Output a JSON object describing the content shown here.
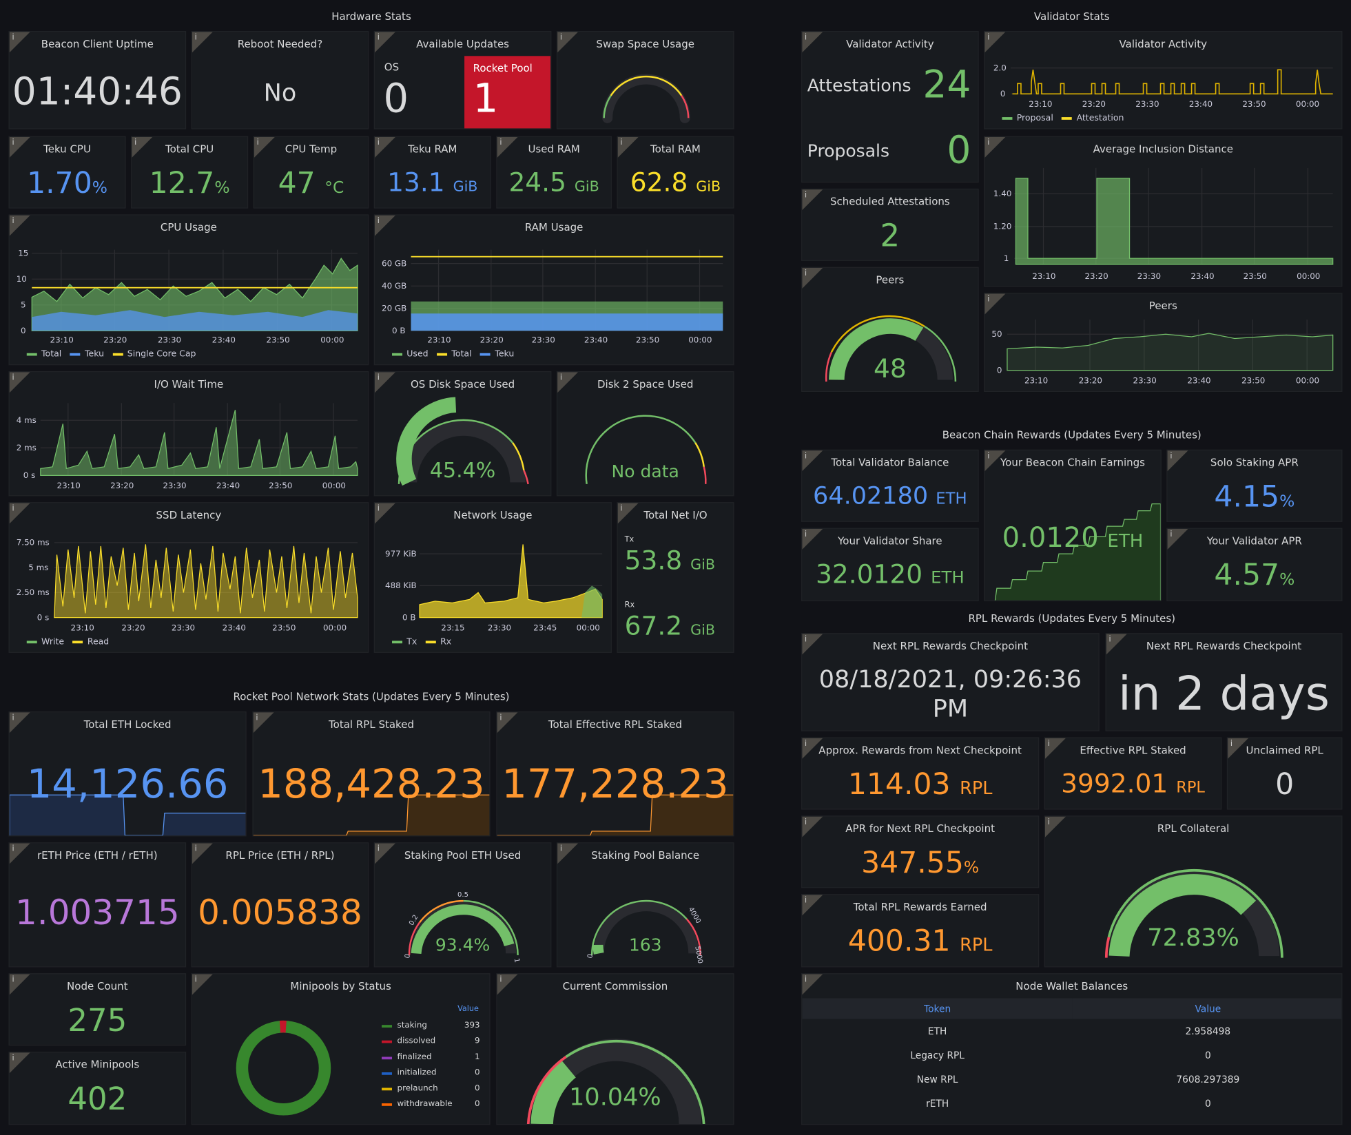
{
  "sections": {
    "hardware": "Hardware Stats",
    "validator": "Validator Stats",
    "beacon": "Beacon Chain Rewards (Updates Every 5 Minutes)",
    "rpl": "RPL Rewards (Updates Every 5 Minutes)",
    "network": "Rocket Pool Network Stats (Updates Every 5 Minutes)"
  },
  "info_icon": "i",
  "colors": {
    "green": "#73bf69",
    "blue": "#5794f2",
    "yellow": "#fade2a",
    "orange": "#ff9830",
    "purple": "#b877d9",
    "red": "#c4162a",
    "panel": "#181b1f",
    "bg": "#111217"
  },
  "hw": {
    "uptime": {
      "title": "Beacon Client Uptime",
      "value": "01:40:46"
    },
    "reboot": {
      "title": "Reboot Needed?",
      "value": "No"
    },
    "updates": {
      "title": "Available Updates",
      "os_label": "OS",
      "os_value": "0",
      "rp_label": "Rocket Pool",
      "rp_value": "1"
    },
    "swap": {
      "title": "Swap Space Usage",
      "level": 0
    },
    "teku_cpu": {
      "title": "Teku CPU",
      "value": "1.70",
      "unit": "%"
    },
    "total_cpu": {
      "title": "Total CPU",
      "value": "12.7",
      "unit": "%"
    },
    "cpu_temp": {
      "title": "CPU Temp",
      "value": "47",
      "unit": "°C"
    },
    "teku_ram": {
      "title": "Teku RAM",
      "value": "13.1",
      "unit": "GiB"
    },
    "used_ram": {
      "title": "Used RAM",
      "value": "24.5",
      "unit": "GiB"
    },
    "total_ram": {
      "title": "Total RAM",
      "value": "62.8",
      "unit": "GiB"
    },
    "cpu_usage": {
      "title": "CPU Usage",
      "yticks": [
        "15",
        "10",
        "5",
        "0"
      ],
      "xticks": [
        "23:10",
        "23:20",
        "23:30",
        "23:40",
        "23:50",
        "00:00"
      ],
      "legend": [
        "Total",
        "Teku",
        "Single Core Cap"
      ]
    },
    "ram_usage": {
      "title": "RAM Usage",
      "yticks": [
        "60 GB",
        "40 GB",
        "20 GB",
        "0 B"
      ],
      "xticks": [
        "23:10",
        "23:20",
        "23:30",
        "23:40",
        "23:50",
        "00:00"
      ],
      "legend": [
        "Used",
        "Total",
        "Teku"
      ]
    },
    "io_wait": {
      "title": "I/O Wait Time",
      "yticks": [
        "4 ms",
        "2 ms",
        "0 s"
      ],
      "xticks": [
        "23:10",
        "23:20",
        "23:30",
        "23:40",
        "23:50",
        "00:00"
      ]
    },
    "os_disk": {
      "title": "OS Disk Space Used",
      "value": "45.4%",
      "level": 0.454
    },
    "disk2": {
      "title": "Disk 2 Space Used",
      "value": "No data"
    },
    "ssd": {
      "title": "SSD Latency",
      "yticks": [
        "7.50 ms",
        "5 ms",
        "2.50 ms",
        "0 s"
      ],
      "xticks": [
        "23:10",
        "23:20",
        "23:30",
        "23:40",
        "23:50",
        "00:00"
      ],
      "legend": [
        "Write",
        "Read"
      ]
    },
    "net_usage": {
      "title": "Network Usage",
      "yticks": [
        "977 KiB",
        "488 KiB",
        "0 B"
      ],
      "xticks": [
        "23:15",
        "23:30",
        "23:45",
        "00:00"
      ],
      "legend": [
        "Tx",
        "Rx"
      ]
    },
    "net_io": {
      "title": "Total Net I/O",
      "tx_label": "Tx",
      "tx_value": "53.8",
      "tx_unit": "GiB",
      "rx_label": "Rx",
      "rx_value": "67.2",
      "rx_unit": "GiB"
    }
  },
  "val": {
    "activity": {
      "title": "Validator Activity",
      "att_label": "Attestations",
      "att_value": "24",
      "prop_label": "Proposals",
      "prop_value": "0"
    },
    "activity_chart": {
      "title": "Validator Activity",
      "yticks": [
        "2.0",
        "0"
      ],
      "xticks": [
        "23:10",
        "23:20",
        "23:30",
        "23:40",
        "23:50",
        "00:00"
      ],
      "legend": [
        "Proposal",
        "Attestation"
      ]
    },
    "sched": {
      "title": "Scheduled Attestations",
      "value": "2"
    },
    "incl": {
      "title": "Average Inclusion Distance",
      "yticks": [
        "1.40",
        "1.20",
        "1"
      ],
      "xticks": [
        "23:10",
        "23:20",
        "23:30",
        "23:40",
        "23:50",
        "00:00"
      ]
    },
    "peers": {
      "title": "Peers",
      "value": "48",
      "level": 0.48
    },
    "peers_chart": {
      "title": "Peers",
      "yticks": [
        "50",
        "0"
      ],
      "xticks": [
        "23:10",
        "23:20",
        "23:30",
        "23:40",
        "23:50",
        "00:00"
      ]
    }
  },
  "beacon": {
    "balance": {
      "title": "Total Validator Balance",
      "value": "64.02180",
      "unit": "ETH"
    },
    "earnings": {
      "title": "Your Beacon Chain Earnings",
      "value": "0.0120",
      "unit": "ETH"
    },
    "solo_apr": {
      "title": "Solo Staking APR",
      "value": "4.15",
      "unit": "%"
    },
    "share": {
      "title": "Your Validator Share",
      "value": "32.0120",
      "unit": "ETH"
    },
    "your_apr": {
      "title": "Your Validator APR",
      "value": "4.57",
      "unit": "%"
    }
  },
  "rpl": {
    "checkpoint1": {
      "title": "Next RPL Rewards Checkpoint",
      "line1": "08/18/2021, 09:26:36",
      "line2": "PM"
    },
    "checkpoint2": {
      "title": "Next RPL Rewards Checkpoint",
      "value": "in 2 days"
    },
    "approx": {
      "title": "Approx. Rewards from Next Checkpoint",
      "value": "114.03",
      "unit": "RPL"
    },
    "eff_staked": {
      "title": "Effective RPL Staked",
      "value": "3992.01",
      "unit": "RPL"
    },
    "unclaimed": {
      "title": "Unclaimed RPL",
      "value": "0"
    },
    "apr": {
      "title": "APR for Next RPL Checkpoint",
      "value": "347.55",
      "unit": "%"
    },
    "collateral": {
      "title": "RPL Collateral",
      "value": "72.83%",
      "level": 0.7283
    },
    "total_earned": {
      "title": "Total RPL Rewards Earned",
      "value": "400.31",
      "unit": "RPL"
    },
    "wallet": {
      "title": "Node Wallet Balances",
      "headers": [
        "Token",
        "Value"
      ],
      "rows": [
        [
          "ETH",
          "2.958498"
        ],
        [
          "Legacy RPL",
          "0"
        ],
        [
          "New RPL",
          "7608.297389"
        ],
        [
          "rETH",
          "0"
        ]
      ]
    }
  },
  "net": {
    "eth_locked": {
      "title": "Total ETH Locked",
      "value": "14,126.66"
    },
    "rpl_staked": {
      "title": "Total RPL Staked",
      "value": "188,428.23"
    },
    "eff_rpl": {
      "title": "Total Effective RPL Staked",
      "value": "177,228.23"
    },
    "reth": {
      "title": "rETH Price (ETH / rETH)",
      "value": "1.003715"
    },
    "rpl_price": {
      "title": "RPL Price (ETH / RPL)",
      "value": "0.005838"
    },
    "pool_used": {
      "title": "Staking Pool ETH Used",
      "value": "93.4%",
      "level": 0.934,
      "ticks": [
        "0",
        "0.2",
        "0.5",
        "1"
      ]
    },
    "pool_bal": {
      "title": "Staking Pool Balance",
      "value": "163",
      "level": 0.0326,
      "ticks": [
        "0",
        "4000",
        "5000"
      ]
    },
    "node_count": {
      "title": "Node Count",
      "value": "275"
    },
    "active_mp": {
      "title": "Active Minipools",
      "value": "402"
    },
    "minipools": {
      "title": "Minipools by Status",
      "value_header": "Value",
      "items": [
        {
          "name": "staking",
          "value": "393",
          "color": "#37872d"
        },
        {
          "name": "dissolved",
          "value": "9",
          "color": "#c4162a"
        },
        {
          "name": "finalized",
          "value": "1",
          "color": "#8f3bb8"
        },
        {
          "name": "initialized",
          "value": "0",
          "color": "#1f60c4"
        },
        {
          "name": "prelaunch",
          "value": "0",
          "color": "#e0b400"
        },
        {
          "name": "withdrawable",
          "value": "0",
          "color": "#fa6400"
        }
      ]
    },
    "commission": {
      "title": "Current Commission",
      "value": "10.04%",
      "level": 0.1004
    }
  }
}
